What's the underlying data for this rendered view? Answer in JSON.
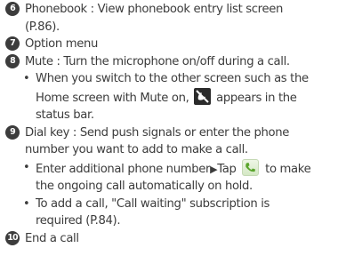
{
  "items": [
    {
      "number": "6",
      "line1": "Phonebook : View phonebook entry list screen",
      "line2": "(P.86)."
    },
    {
      "number": "7",
      "line1": "Option menu"
    },
    {
      "number": "8",
      "line1": "Mute : Turn the microphone on/off during a call.",
      "bullet": {
        "line1": "When you switch to the other screen such as the",
        "line2a": "Home screen with Mute on,",
        "line2b": "appears in the",
        "line3": "status bar."
      }
    },
    {
      "number": "9",
      "line1": "Dial key : Send push signals or enter the phone",
      "line2": "number you want to add to make a call.",
      "bullet1": {
        "line1a": "Enter additional phone number",
        "line1b": "Tap",
        "line1c": "to make",
        "line2": "the ongoing call automatically on hold."
      },
      "bullet2": {
        "line1": "To add a call, \"Call waiting\" subscription is",
        "line2": "required (P.84)."
      }
    },
    {
      "number": "10",
      "line1": "End a call"
    }
  ],
  "icons": {
    "mute": "mute-status-icon",
    "call": "call-icon",
    "arrow": "right-triangle-arrow"
  },
  "bullet_char": "•",
  "arrow_char": "▶",
  "colors": {
    "text": "#3c3c3c",
    "call_icon_green": "#5aa52c"
  }
}
